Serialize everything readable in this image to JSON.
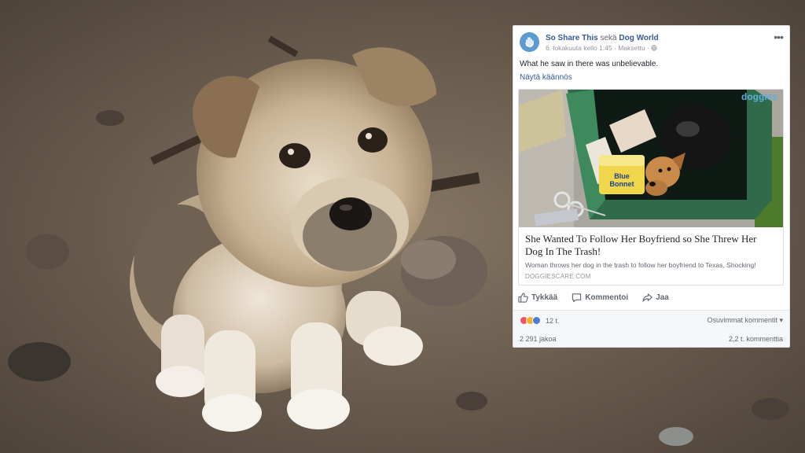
{
  "post": {
    "author": "So Share This",
    "joiner": "sekä",
    "coauthor": "Dog World",
    "date": "6. lokakuuta kello 1:45",
    "separator": "·",
    "sponsored": "Maksettu",
    "menu": "•••",
    "text": "What he saw in there was unbelievable.",
    "see_translation": "Näytä käännös"
  },
  "link": {
    "brand": "doggies",
    "title": "She Wanted To Follow Her Boyfriend so She Threw Her Dog In The Trash!",
    "description": "Woman throws her dog in the trash to follow her boyfriend to Texas, Shocking!",
    "domain": "DOGGIESCARE.COM",
    "box_label_1": "Blue",
    "box_label_2": "Bonnet"
  },
  "actions": {
    "like": "Tykkää",
    "comment": "Kommentoi",
    "share": "Jaa"
  },
  "reactions": {
    "count": "12 t.",
    "sort": "Osuvimmat kommentit ▾"
  },
  "stats": {
    "shares": "2 291 jakoa",
    "comments": "2,2 t. kommenttia"
  },
  "colors": {
    "link_blue": "#365899",
    "angry": "#f25268",
    "sad": "#f7b125",
    "like": "#4d7bd6"
  }
}
